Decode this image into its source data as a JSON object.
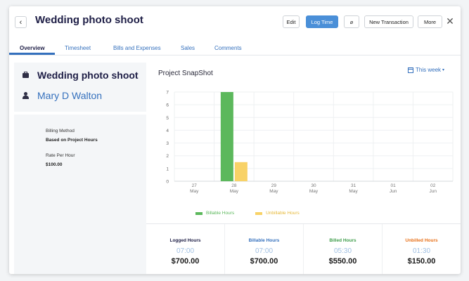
{
  "header": {
    "back_glyph": "‹",
    "title": "Wedding photo shoot",
    "buttons": {
      "edit": "Edit",
      "log_time": "Log Time",
      "attach_glyph": "⌀",
      "new_transaction": "New Transaction",
      "more": "More"
    },
    "close_glyph": "✕"
  },
  "tabs": [
    {
      "label": "Overview",
      "active": true
    },
    {
      "label": "Timesheet"
    },
    {
      "label": "Bills and Expenses"
    },
    {
      "label": "Sales"
    },
    {
      "label": "Comments"
    }
  ],
  "project": {
    "title": "Wedding photo shoot",
    "customer": "Mary D Walton",
    "billing_method_label": "Billing Method",
    "billing_method_value": "Based on Project Hours",
    "rate_label": "Rate Per Hour",
    "rate_value": "$100.00"
  },
  "snapshot": {
    "title": "Project SnapShot",
    "period": "This week",
    "period_caret": "▾"
  },
  "chart_data": {
    "type": "bar",
    "categories": [
      "27 May",
      "28 May",
      "29 May",
      "30 May",
      "31 May",
      "01 Jun",
      "02 Jun"
    ],
    "tick_lines": [
      [
        "27",
        "May"
      ],
      [
        "28",
        "May"
      ],
      [
        "29",
        "May"
      ],
      [
        "30",
        "May"
      ],
      [
        "31",
        "May"
      ],
      [
        "01",
        "Jun"
      ],
      [
        "02",
        "Jun"
      ]
    ],
    "series": [
      {
        "name": "Billable Hours",
        "color": "#5cb85c",
        "values": [
          0,
          7,
          0,
          0,
          0,
          0,
          0
        ]
      },
      {
        "name": "Unbillable Hours",
        "color": "#f8d267",
        "values": [
          0,
          1.5,
          0,
          0,
          0,
          0,
          0
        ]
      }
    ],
    "yticks": [
      0,
      1,
      2,
      3,
      4,
      5,
      6,
      7
    ],
    "ylim": [
      0,
      7
    ],
    "grid": true
  },
  "stats": [
    {
      "label": "Logged Hours",
      "color": "#1e1e46",
      "time": "07:00",
      "amount": "$700.00"
    },
    {
      "label": "Billable Hours",
      "color": "#3470bd",
      "time": "07:00",
      "amount": "$700.00"
    },
    {
      "label": "Billed Hours",
      "color": "#3f9d4b",
      "time": "05:30",
      "amount": "$550.00"
    },
    {
      "label": "Unbilled Hours",
      "color": "#e8711a",
      "time": "01:30",
      "amount": "$150.00"
    }
  ]
}
